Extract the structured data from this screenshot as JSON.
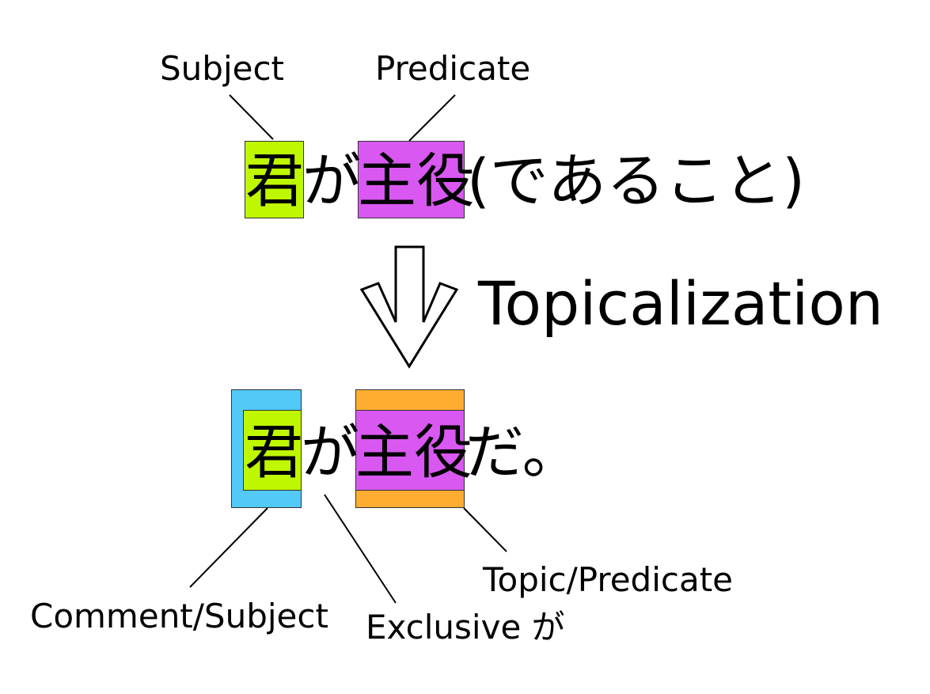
{
  "colors": {
    "subject": "#bff700",
    "predicate": "#d958f2",
    "comment": "#52c9f7",
    "topic": "#ffac33",
    "text": "#000000"
  },
  "top": {
    "subject_label": "Subject",
    "predicate_label": "Predicate",
    "subject_char": "君",
    "particle": "が",
    "predicate_chars": "主役",
    "tail": "(であること)"
  },
  "arrow": {
    "label": "Topicalization",
    "icon": "hollow-down-arrow"
  },
  "bottom": {
    "subject_char": "君",
    "particle": "が",
    "predicate_chars": "主役",
    "tail": "だ。",
    "comment_label": "Comment/Subject",
    "exclusive_label": "Exclusive が",
    "topic_label": "Topic/Predicate"
  }
}
